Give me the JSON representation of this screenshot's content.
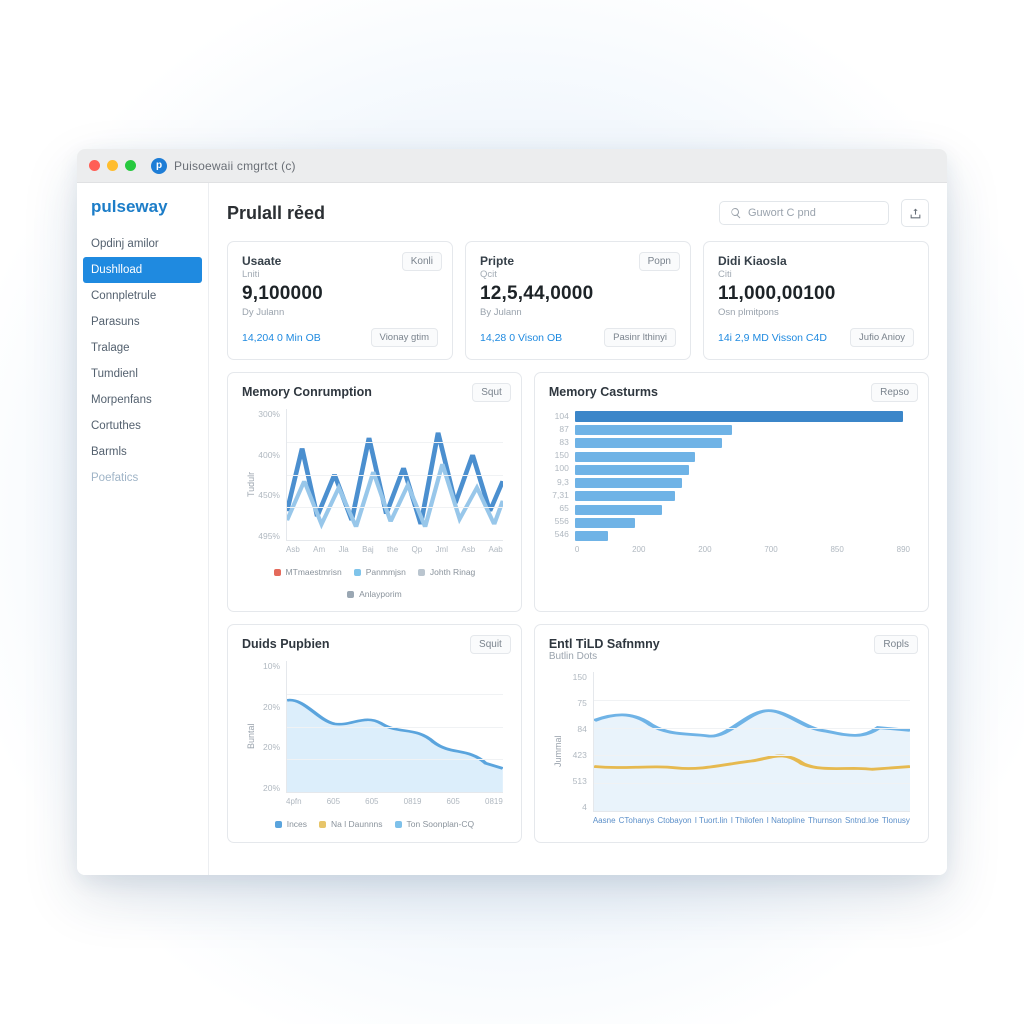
{
  "window": {
    "title": "Puisoewaii cmgrtct (c)"
  },
  "brand": "pulseway",
  "sidebar": {
    "items": [
      {
        "label": "Opdinj amilor"
      },
      {
        "label": "Dushlload",
        "active": true
      },
      {
        "label": "Connpletrule"
      },
      {
        "label": "Parasuns"
      },
      {
        "label": "Tralage"
      },
      {
        "label": "Tumdienl"
      },
      {
        "label": "Morpenfans"
      },
      {
        "label": "Cortuthes"
      },
      {
        "label": "Barmls"
      },
      {
        "label": "Poefatics",
        "muted": true
      }
    ]
  },
  "header": {
    "title": "Prulall rẻed",
    "search_placeholder": "Guwort C pnd"
  },
  "stats": [
    {
      "title": "Usaate",
      "sub": "Lniti",
      "value": "9,100000",
      "note": "Dy Julann",
      "link": "14,204 0 Min OB",
      "chip": "Konli",
      "action": "Vionay gtim"
    },
    {
      "title": "Pripte",
      "sub": "Qcit",
      "value": "12,5,44,0000",
      "note": "By Julann",
      "link": "14,28 0 Vison OB",
      "chip": "Popn",
      "action": "Pasinr lthinyi"
    },
    {
      "title": "Didi Kiaosla",
      "sub": "Citi",
      "value": "11,000,00100",
      "note": "Osn plmitpons",
      "link": "14i 2,9 MD Visson C4D",
      "chip": "",
      "action": "Jufio Anioy"
    }
  ],
  "charts": {
    "mem_consumption": {
      "title": "Memory Conrumption",
      "chip": "Squt",
      "ylabel": "Tudulr",
      "yticks": [
        "300%",
        "400%",
        "450%",
        "495%"
      ],
      "xticks": [
        "Asb",
        "Am",
        "Jla",
        "Baj",
        "the",
        "Qp",
        "Jml",
        "Asb",
        "Aab"
      ],
      "legend": [
        {
          "label": "MTmaestmrisn",
          "color": "#e46a5b"
        },
        {
          "label": "Panmmjsn",
          "color": "#7fc4ea"
        },
        {
          "label": "Johth Rinag",
          "color": "#bac5cf"
        },
        {
          "label": "Anlayporim",
          "color": "#9aa7b3"
        }
      ]
    },
    "mem_custurms": {
      "title": "Memory Casturms",
      "chip": "Repso",
      "yticks": [
        "104",
        "87",
        "83",
        "150",
        "100",
        "9,3",
        "7,31",
        "65",
        "556",
        "546"
      ],
      "xticks": [
        "0",
        "200",
        "200",
        "700",
        "850",
        "890"
      ]
    },
    "duids": {
      "title": "Duids Pupbien",
      "chip": "Squit",
      "ylabel": "Buntal",
      "yticks": [
        "10%",
        "20%",
        "20%",
        "20%"
      ],
      "xticks": [
        "4pfn",
        "605",
        "605",
        "0819",
        "605",
        "0819"
      ],
      "legend": [
        {
          "label": "Inces",
          "color": "#5aa4dd"
        },
        {
          "label": "Na l Daunnns",
          "color": "#e7c56a"
        },
        {
          "label": "Ton Soonplan-CQ",
          "color": "#7ec1ea"
        }
      ]
    },
    "entl": {
      "title": "Entl TiLD Safnmny",
      "sub": "Butlin Dots",
      "chip": "Ropls",
      "ylabel": "Jummal",
      "yticks": [
        "150",
        "75",
        "84",
        "423",
        "513",
        "4"
      ],
      "xticks": [
        "Aasne",
        "CTohanys",
        "Ctobayon",
        "I Tuort.lin",
        "I Thilofen",
        "I Natopline",
        "Thurnson",
        "Sntnd.loe",
        "Tlonusy"
      ]
    }
  },
  "colors": {
    "accent": "#1f8ae0",
    "line_primary": "#4b8fcf",
    "line_secondary": "#98c7ea",
    "area_fill": "#dceefb",
    "yellow": "#e6b94f"
  },
  "chart_data": [
    {
      "id": "mem_consumption",
      "type": "line",
      "title": "Memory Conrumption",
      "xlabel": "",
      "ylabel": "Tudulr",
      "ylim": [
        300,
        500
      ],
      "categories": [
        "Asb",
        "Am",
        "Jla",
        "Baj",
        "the",
        "Qp",
        "Jml",
        "Asb",
        "Aab"
      ],
      "series": [
        {
          "name": "MTmaestmrisn",
          "color": "#e46a5b",
          "values": [
            320,
            340,
            330,
            350,
            340,
            360,
            350,
            345,
            340
          ]
        },
        {
          "name": "Panmmjsn",
          "color": "#7fc4ea",
          "values": [
            350,
            470,
            330,
            420,
            340,
            440,
            320,
            430,
            360
          ]
        },
        {
          "name": "Johth Rinag",
          "color": "#4b8fcf",
          "values": [
            360,
            430,
            350,
            490,
            360,
            480,
            350,
            470,
            400
          ]
        },
        {
          "name": "Anlayporim",
          "color": "#9aa7b3",
          "values": [
            340,
            380,
            345,
            400,
            350,
            395,
            348,
            390,
            360
          ]
        }
      ]
    },
    {
      "id": "mem_custurms",
      "type": "bar",
      "orientation": "horizontal",
      "title": "Memory Casturms",
      "xlabel": "",
      "ylabel": "",
      "xlim": [
        0,
        900
      ],
      "categories": [
        "104",
        "87",
        "83",
        "150",
        "100",
        "9,3",
        "7,31",
        "65",
        "556",
        "546"
      ],
      "values": [
        880,
        420,
        400,
        320,
        300,
        290,
        270,
        230,
        160,
        90
      ]
    },
    {
      "id": "duids",
      "type": "area",
      "title": "Duids Pupbien",
      "xlabel": "",
      "ylabel": "Buntal",
      "ylim": [
        0,
        40
      ],
      "categories": [
        "4pfn",
        "605",
        "605",
        "0819",
        "605",
        "0819"
      ],
      "series": [
        {
          "name": "Inces",
          "color": "#5aa4dd",
          "values": [
            32,
            28,
            25,
            27,
            22,
            19
          ]
        },
        {
          "name": "Na l Daunnns",
          "color": "#e7c56a",
          "values": [
            20,
            18,
            17,
            18,
            15,
            13
          ]
        },
        {
          "name": "Ton Soonplan-CQ",
          "color": "#7ec1ea",
          "values": [
            26,
            22,
            20,
            23,
            18,
            15
          ]
        }
      ]
    },
    {
      "id": "entl",
      "type": "line",
      "title": "Entl TiLD Safnmny",
      "xlabel": "",
      "ylabel": "Jummal",
      "ylim": [
        0,
        160
      ],
      "categories": [
        "Aasne",
        "CTohanys",
        "Ctobayon",
        "I Tuort.lin",
        "I Thilofen",
        "I Natopline",
        "Thurnson",
        "Sntnd.loe",
        "Tlonusy"
      ],
      "series": [
        {
          "name": "series-a",
          "color": "#6fb3e6",
          "values": [
            110,
            118,
            102,
            98,
            100,
            125,
            112,
            95,
            105
          ]
        },
        {
          "name": "series-b",
          "color": "#e6b94f",
          "values": [
            58,
            55,
            57,
            56,
            55,
            75,
            58,
            54,
            56
          ]
        }
      ]
    }
  ]
}
